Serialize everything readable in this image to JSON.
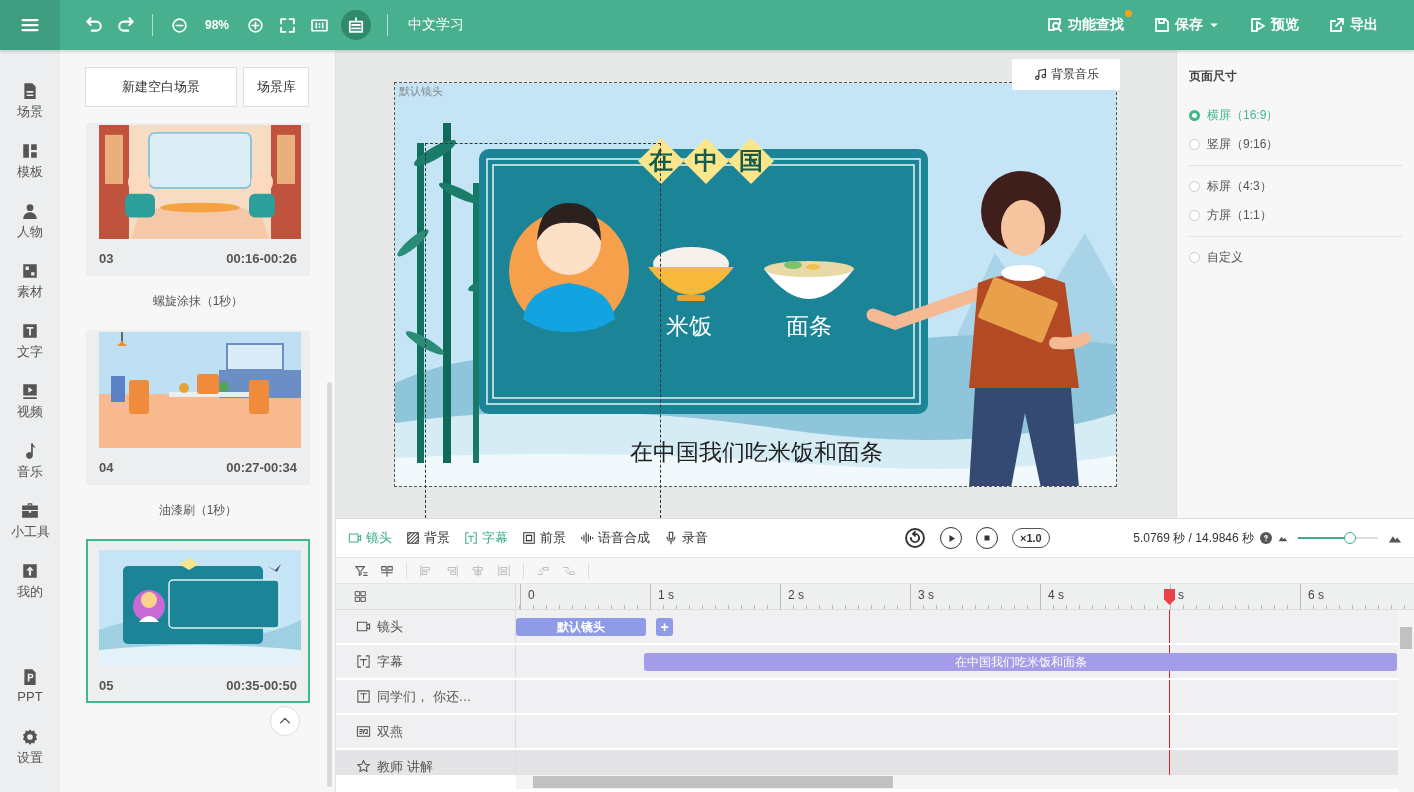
{
  "topbar": {
    "zoom": "98%",
    "project_title": "中文学习",
    "actions": [
      {
        "label": "功能查找",
        "kind": "search",
        "notification": true,
        "caret": false
      },
      {
        "label": "保存",
        "kind": "save",
        "notification": false,
        "caret": true
      },
      {
        "label": "预览",
        "kind": "preview",
        "notification": false,
        "caret": false
      },
      {
        "label": "导出",
        "kind": "export",
        "notification": false,
        "caret": false
      }
    ]
  },
  "nav": [
    {
      "label": "场景",
      "kind": "scene"
    },
    {
      "label": "模板",
      "kind": "template"
    },
    {
      "label": "人物",
      "kind": "person"
    },
    {
      "label": "素材",
      "kind": "material"
    },
    {
      "label": "文字",
      "kind": "text"
    },
    {
      "label": "视频",
      "kind": "video"
    },
    {
      "label": "音乐",
      "kind": "music"
    },
    {
      "label": "小工具",
      "kind": "tools"
    },
    {
      "label": "我的",
      "kind": "mine"
    },
    {
      "label": "PPT",
      "kind": "ppt"
    },
    {
      "label": "设置",
      "kind": "settings"
    }
  ],
  "scenes": {
    "buttons": [
      "新建空白场景",
      "场景库"
    ],
    "items": [
      {
        "kind": "scene",
        "number": "03",
        "time": "00:16-00:26",
        "selected": false
      },
      {
        "kind": "transition",
        "label": "螺旋涂抹（1秒）"
      },
      {
        "kind": "scene",
        "number": "04",
        "time": "00:27-00:34",
        "selected": false
      },
      {
        "kind": "transition",
        "label": "油漆刷（1秒）"
      },
      {
        "kind": "scene",
        "number": "05",
        "time": "00:35-00:50",
        "selected": true
      }
    ]
  },
  "canvas": {
    "music_button": "背景音乐",
    "camera_label": "默认镜头",
    "slide": {
      "title_chars": [
        "在",
        "中",
        "国"
      ],
      "foods": [
        "米饭",
        "面条"
      ],
      "caption": "在中国我们吃米饭和面条"
    }
  },
  "page_size": {
    "title": "页面尺寸",
    "groups": [
      [
        {
          "label": "横屏（16:9）",
          "selected": true
        },
        {
          "label": "竖屏（9:16）",
          "selected": false
        }
      ],
      [
        {
          "label": "标屏（4:3）",
          "selected": false
        },
        {
          "label": "方屏（1:1）",
          "selected": false
        }
      ],
      [
        {
          "label": "自定义",
          "selected": false
        }
      ]
    ]
  },
  "timeline": {
    "tabs": [
      {
        "label": "镜头",
        "kind": "camera",
        "active": true
      },
      {
        "label": "背景",
        "kind": "background",
        "active": false
      },
      {
        "label": "字幕",
        "kind": "subtitle",
        "active": true
      },
      {
        "label": "前景",
        "kind": "foreground",
        "active": false
      },
      {
        "label": "语音合成",
        "kind": "speech",
        "active": false
      },
      {
        "label": "录音",
        "kind": "mic",
        "active": false
      }
    ],
    "speed": "×1.0",
    "time": "5.0769 秒 / 14.9846 秒",
    "zoom": {
      "level": 0.65
    },
    "ruler": [
      "0",
      "1 s",
      "2 s",
      "3 s",
      "4 s",
      "s",
      "6 s"
    ],
    "tracks": [
      {
        "label": "镜头",
        "kind": "camera",
        "selected": false,
        "clip": "默认镜头",
        "add_button": "+"
      },
      {
        "label": "字幕",
        "kind": "subtitle",
        "selected": false,
        "clip": "在中国我们吃米饭和面条"
      },
      {
        "label": "同学们， 你还…",
        "kind": "text",
        "selected": false
      },
      {
        "label": "双燕",
        "kind": "svg",
        "selected": false
      },
      {
        "label": "教师 讲解",
        "kind": "character",
        "selected": true
      }
    ]
  }
}
